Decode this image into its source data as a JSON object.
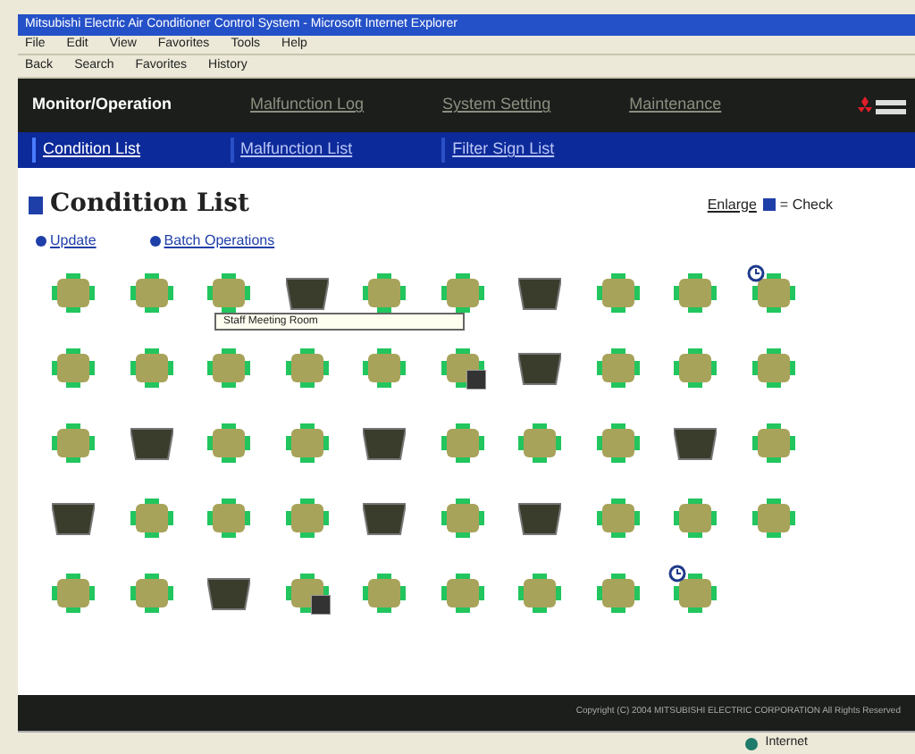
{
  "window": {
    "title": "Mitsubishi Electric Air Conditioner Control System - Microsoft Internet Explorer"
  },
  "menu": [
    "File",
    "Edit",
    "View",
    "Favorites",
    "Tools",
    "Help"
  ],
  "toolbar": [
    "Back",
    "Search",
    "Favorites",
    "History"
  ],
  "header": {
    "tabs": [
      {
        "label": "Monitor/Operation",
        "selected": true
      },
      {
        "label": "Malfunction Log",
        "selected": false
      },
      {
        "label": "System Setting",
        "selected": false
      },
      {
        "label": "Maintenance",
        "selected": false
      }
    ]
  },
  "subnav": [
    {
      "label": "Condition List",
      "selected": true
    },
    {
      "label": "Malfunction List",
      "selected": false
    },
    {
      "label": "Filter Sign List",
      "selected": false
    }
  ],
  "page": {
    "title": "Condition List",
    "enlarge": "Enlarge",
    "legend": "= Check",
    "links": [
      "Update",
      "Batch Operations"
    ]
  },
  "tooltip": "Staff Meeting Room",
  "units": [
    [
      {
        "kind": "on",
        "filter_sign": false,
        "timer": false
      },
      {
        "kind": "on",
        "filter_sign": false,
        "timer": false
      },
      {
        "kind": "on",
        "filter_sign": false,
        "timer": false
      },
      {
        "kind": "off",
        "filter_sign": false,
        "timer": false
      },
      {
        "kind": "on",
        "filter_sign": false,
        "timer": false
      },
      {
        "kind": "on",
        "filter_sign": false,
        "timer": false
      },
      {
        "kind": "off",
        "filter_sign": false,
        "timer": false
      },
      {
        "kind": "on",
        "filter_sign": false,
        "timer": false
      },
      {
        "kind": "on",
        "filter_sign": false,
        "timer": false
      },
      {
        "kind": "on",
        "filter_sign": false,
        "timer": true
      }
    ],
    [
      {
        "kind": "on",
        "filter_sign": false,
        "timer": false
      },
      {
        "kind": "on",
        "filter_sign": false,
        "timer": false
      },
      {
        "kind": "on",
        "filter_sign": false,
        "timer": false
      },
      {
        "kind": "on",
        "filter_sign": false,
        "timer": false
      },
      {
        "kind": "on",
        "filter_sign": false,
        "timer": false
      },
      {
        "kind": "on",
        "filter_sign": true,
        "timer": false
      },
      {
        "kind": "off",
        "filter_sign": false,
        "timer": false
      },
      {
        "kind": "on",
        "filter_sign": false,
        "timer": false
      },
      {
        "kind": "on",
        "filter_sign": false,
        "timer": false
      },
      {
        "kind": "on",
        "filter_sign": false,
        "timer": false
      }
    ],
    [
      {
        "kind": "on",
        "filter_sign": false,
        "timer": false
      },
      {
        "kind": "off",
        "filter_sign": false,
        "timer": false
      },
      {
        "kind": "on",
        "filter_sign": false,
        "timer": false
      },
      {
        "kind": "on",
        "filter_sign": false,
        "timer": false
      },
      {
        "kind": "off",
        "filter_sign": false,
        "timer": false
      },
      {
        "kind": "on",
        "filter_sign": false,
        "timer": false
      },
      {
        "kind": "on",
        "filter_sign": false,
        "timer": false
      },
      {
        "kind": "on",
        "filter_sign": false,
        "timer": false
      },
      {
        "kind": "off",
        "filter_sign": false,
        "timer": false
      },
      {
        "kind": "on",
        "filter_sign": false,
        "timer": false
      }
    ],
    [
      {
        "kind": "off",
        "filter_sign": false,
        "timer": false
      },
      {
        "kind": "on",
        "filter_sign": false,
        "timer": false
      },
      {
        "kind": "on",
        "filter_sign": false,
        "timer": false
      },
      {
        "kind": "on",
        "filter_sign": false,
        "timer": false
      },
      {
        "kind": "off",
        "filter_sign": false,
        "timer": false
      },
      {
        "kind": "on",
        "filter_sign": false,
        "timer": false
      },
      {
        "kind": "off",
        "filter_sign": false,
        "timer": false
      },
      {
        "kind": "on",
        "filter_sign": false,
        "timer": false
      },
      {
        "kind": "on",
        "filter_sign": false,
        "timer": false
      },
      {
        "kind": "on",
        "filter_sign": false,
        "timer": false
      }
    ],
    [
      {
        "kind": "on",
        "filter_sign": false,
        "timer": false
      },
      {
        "kind": "on",
        "filter_sign": false,
        "timer": false
      },
      {
        "kind": "off",
        "filter_sign": false,
        "timer": false
      },
      {
        "kind": "on",
        "filter_sign": true,
        "timer": false
      },
      {
        "kind": "on",
        "filter_sign": false,
        "timer": false
      },
      {
        "kind": "on",
        "filter_sign": false,
        "timer": false
      },
      {
        "kind": "on",
        "filter_sign": false,
        "timer": false
      },
      {
        "kind": "on",
        "filter_sign": false,
        "timer": false
      },
      {
        "kind": "on",
        "filter_sign": false,
        "timer": true
      }
    ]
  ],
  "footer": "Copyright (C) 2004 MITSUBISHI ELECTRIC CORPORATION All Rights Reserved",
  "status_bar": {
    "zone": "Internet"
  }
}
